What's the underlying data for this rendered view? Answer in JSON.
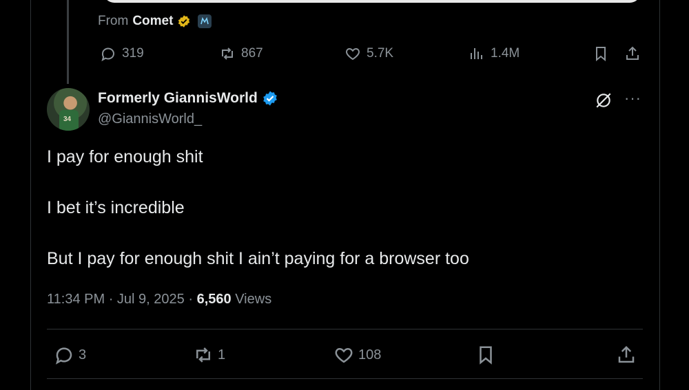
{
  "quoted": {
    "from_label": "From",
    "from_name": "Comet",
    "metrics": {
      "replies": "319",
      "reposts": "867",
      "likes": "5.7K",
      "views": "1.4M"
    }
  },
  "tweet": {
    "display_name": "Formerly GiannisWorld",
    "handle": "@GiannisWorld_",
    "avatar_number": "34",
    "lines": [
      "I pay for enough shit",
      "I bet it’s incredible",
      "But I pay for enough shit I ain’t paying for a browser too"
    ],
    "time": "11:34 PM",
    "date": "Jul 9, 2025",
    "separator": "·",
    "views_count": "6,560",
    "views_label": "Views",
    "more_label": "···",
    "actions": {
      "replies": "3",
      "reposts": "1",
      "likes": "108"
    }
  },
  "colors": {
    "background": "#000000",
    "text": "#e7e9ea",
    "muted": "#8b9298",
    "verified_blue": "#1d9bf0",
    "verified_gold": "#e2b719"
  }
}
